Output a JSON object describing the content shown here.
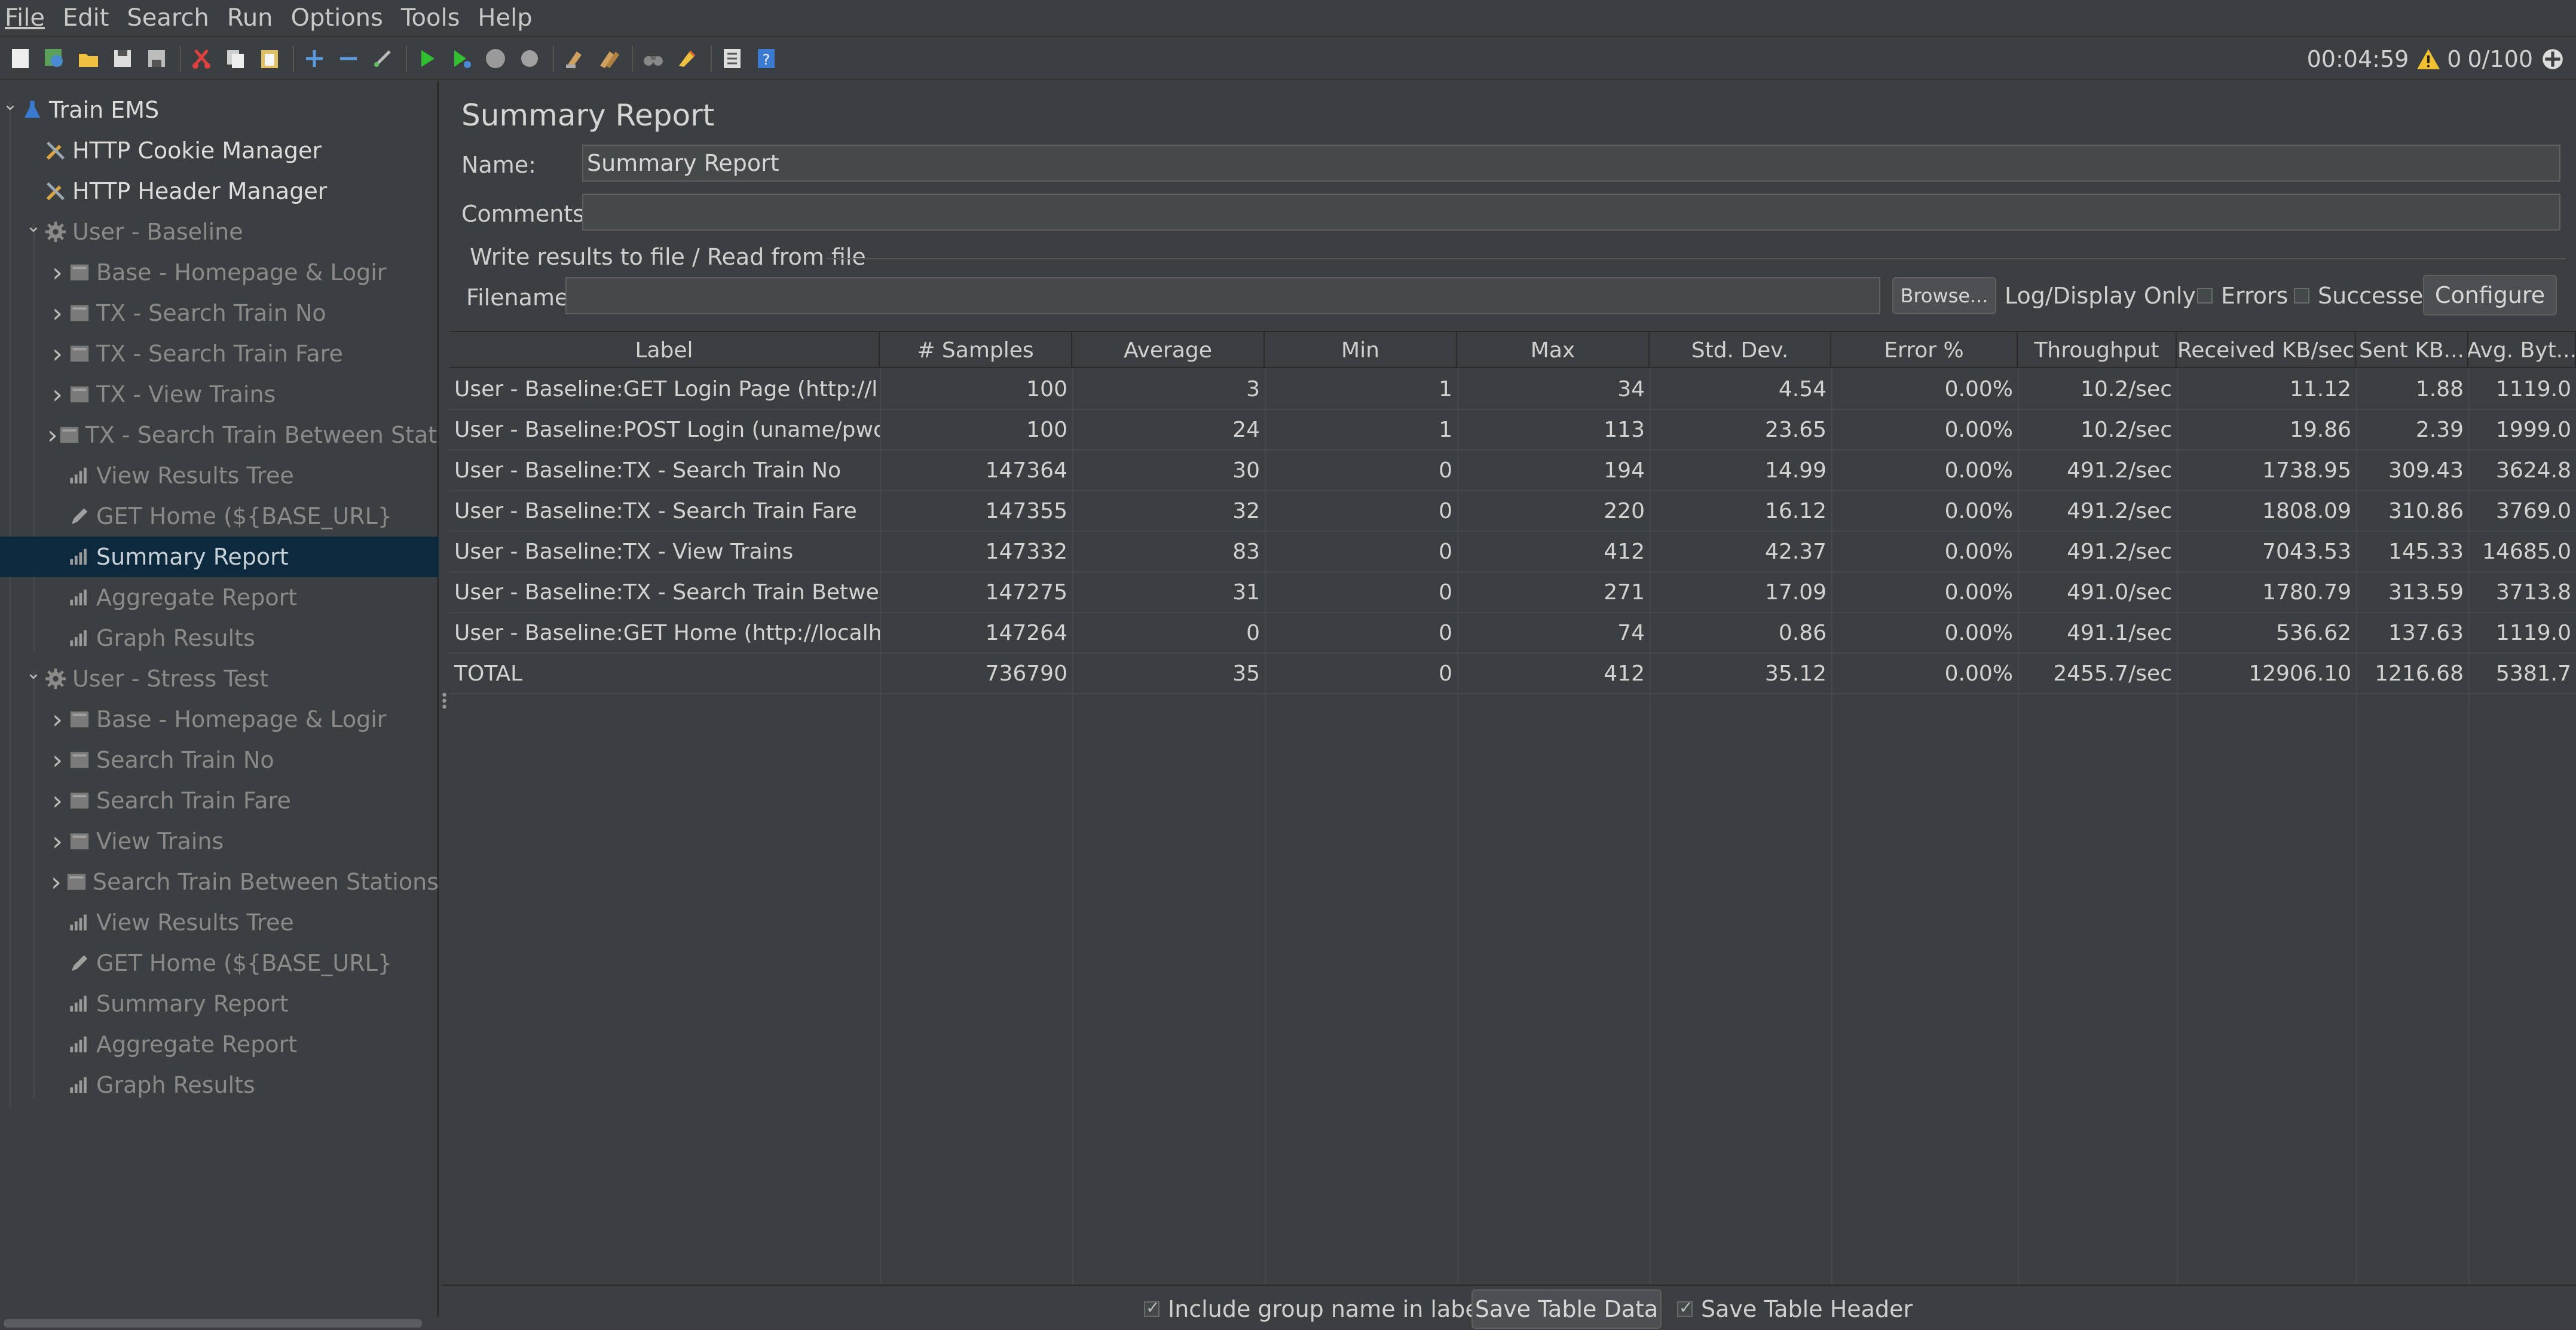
{
  "menu": [
    "File",
    "Edit",
    "Search",
    "Run",
    "Options",
    "Tools",
    "Help"
  ],
  "status": {
    "timer": "00:04:59",
    "warnings": "0",
    "threads": "0/100"
  },
  "tree": [
    {
      "label": "Train EMS",
      "icon": "flask-icon",
      "level": 0,
      "arrow": "v",
      "style": "bright"
    },
    {
      "label": "HTTP Cookie Manager",
      "icon": "wrench-icon",
      "level": 1,
      "arrow": "",
      "style": "bright"
    },
    {
      "label": "HTTP Header Manager",
      "icon": "wrench-icon",
      "level": 1,
      "arrow": "",
      "style": "bright"
    },
    {
      "label": "User - Baseline",
      "icon": "gear-icon",
      "level": 1,
      "arrow": "v",
      "style": "dim"
    },
    {
      "label": "Base - Homepage & Logir",
      "icon": "controller-icon",
      "level": 2,
      "arrow": ">",
      "style": "dim"
    },
    {
      "label": "TX - Search Train No",
      "icon": "controller-icon",
      "level": 2,
      "arrow": ">",
      "style": "dim"
    },
    {
      "label": "TX - Search Train Fare",
      "icon": "controller-icon",
      "level": 2,
      "arrow": ">",
      "style": "dim"
    },
    {
      "label": "TX - View Trains",
      "icon": "controller-icon",
      "level": 2,
      "arrow": ">",
      "style": "dim"
    },
    {
      "label": "TX - Search Train Between Station",
      "icon": "controller-icon",
      "level": 2,
      "arrow": ">",
      "style": "dim"
    },
    {
      "label": "View Results Tree",
      "icon": "chart-icon",
      "level": 2,
      "arrow": "",
      "style": "dim"
    },
    {
      "label": "GET Home (${BASE_URL}",
      "icon": "pencil-icon",
      "level": 2,
      "arrow": "",
      "style": "dim"
    },
    {
      "label": "Summary Report",
      "icon": "chart-icon",
      "level": 2,
      "arrow": "",
      "style": "selected"
    },
    {
      "label": "Aggregate Report",
      "icon": "chart-icon",
      "level": 2,
      "arrow": "",
      "style": "dim"
    },
    {
      "label": "Graph Results",
      "icon": "chart-icon",
      "level": 2,
      "arrow": "",
      "style": "dim"
    },
    {
      "label": "User - Stress Test",
      "icon": "gear-icon",
      "level": 1,
      "arrow": "v",
      "style": "dim"
    },
    {
      "label": "Base - Homepage & Logir",
      "icon": "controller-icon",
      "level": 2,
      "arrow": ">",
      "style": "dim"
    },
    {
      "label": "Search Train No",
      "icon": "controller-icon",
      "level": 2,
      "arrow": ">",
      "style": "dim"
    },
    {
      "label": "Search Train Fare",
      "icon": "controller-icon",
      "level": 2,
      "arrow": ">",
      "style": "dim"
    },
    {
      "label": "View Trains",
      "icon": "controller-icon",
      "level": 2,
      "arrow": ">",
      "style": "dim"
    },
    {
      "label": "Search Train Between Stations",
      "icon": "controller-icon",
      "level": 2,
      "arrow": ">",
      "style": "dim"
    },
    {
      "label": "View Results Tree",
      "icon": "chart-icon",
      "level": 2,
      "arrow": "",
      "style": "dim"
    },
    {
      "label": "GET Home (${BASE_URL}",
      "icon": "pencil-icon",
      "level": 2,
      "arrow": "",
      "style": "dim"
    },
    {
      "label": "Summary Report",
      "icon": "chart-icon",
      "level": 2,
      "arrow": "",
      "style": "dim"
    },
    {
      "label": "Aggregate Report",
      "icon": "chart-icon",
      "level": 2,
      "arrow": "",
      "style": "dim"
    },
    {
      "label": "Graph Results",
      "icon": "chart-icon",
      "level": 2,
      "arrow": "",
      "style": "dim"
    }
  ],
  "panel": {
    "title": "Summary Report",
    "name_label": "Name:",
    "name_value": "Summary Report",
    "comments_label": "Comments",
    "comments_value": "",
    "file_group": "Write results to file / Read from file",
    "filename_label": "Filename",
    "filename_value": "",
    "browse_label": "Browse...",
    "log_display_label": "Log/Display Only",
    "errors_label": "Errors",
    "successes_label": "Successes",
    "configure_label": "Configure"
  },
  "table": {
    "columns": [
      "Label",
      "# Samples",
      "Average",
      "Min",
      "Max",
      "Std. Dev.",
      "Error %",
      "Throughput",
      "Received KB/sec",
      "Sent KB...",
      "Avg. Byt..."
    ],
    "rows": [
      [
        "User - Baseline:GET Login Page (http://l...",
        "100",
        "3",
        "1",
        "34",
        "4.54",
        "0.00%",
        "10.2/sec",
        "11.12",
        "1.88",
        "1119.0"
      ],
      [
        "User - Baseline:POST Login (uname/pwo...",
        "100",
        "24",
        "1",
        "113",
        "23.65",
        "0.00%",
        "10.2/sec",
        "19.86",
        "2.39",
        "1999.0"
      ],
      [
        "User - Baseline:TX - Search Train No",
        "147364",
        "30",
        "0",
        "194",
        "14.99",
        "0.00%",
        "491.2/sec",
        "1738.95",
        "309.43",
        "3624.8"
      ],
      [
        "User - Baseline:TX - Search Train Fare",
        "147355",
        "32",
        "0",
        "220",
        "16.12",
        "0.00%",
        "491.2/sec",
        "1808.09",
        "310.86",
        "3769.0"
      ],
      [
        "User - Baseline:TX - View Trains",
        "147332",
        "83",
        "0",
        "412",
        "42.37",
        "0.00%",
        "491.2/sec",
        "7043.53",
        "145.33",
        "14685.0"
      ],
      [
        "User - Baseline:TX - Search Train Betwe...",
        "147275",
        "31",
        "0",
        "271",
        "17.09",
        "0.00%",
        "491.0/sec",
        "1780.79",
        "313.59",
        "3713.8"
      ],
      [
        "User - Baseline:GET Home (http://localh...",
        "147264",
        "0",
        "0",
        "74",
        "0.86",
        "0.00%",
        "491.1/sec",
        "536.62",
        "137.63",
        "1119.0"
      ],
      [
        "TOTAL",
        "736790",
        "35",
        "0",
        "412",
        "35.12",
        "0.00%",
        "2455.7/sec",
        "12906.10",
        "1216.68",
        "5381.7"
      ]
    ]
  },
  "footer": {
    "include_group_label": "Include group name in label?",
    "save_table_data": "Save Table Data",
    "save_table_header": "Save Table Header"
  }
}
